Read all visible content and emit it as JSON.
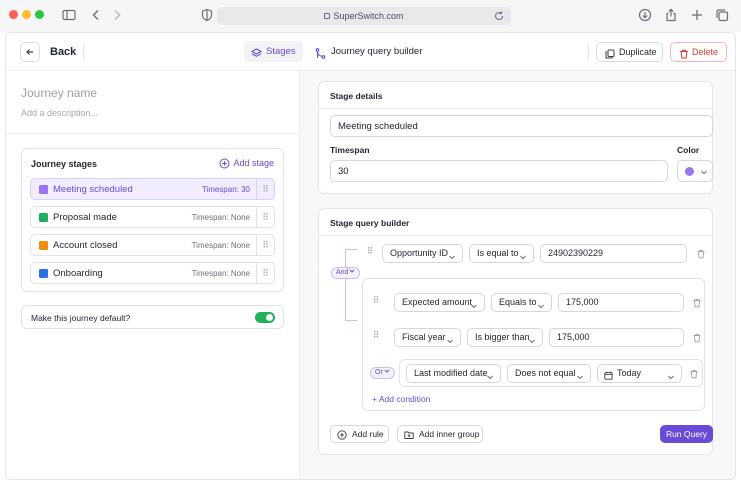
{
  "browser": {
    "url": "SuperSwitch.com"
  },
  "header": {
    "back_label": "Back",
    "stages_tab": "Stages",
    "builder_tab": "Journey query builder",
    "duplicate_label": "Duplicate",
    "delete_label": "Delete"
  },
  "journey": {
    "name_placeholder": "Journey name",
    "description_placeholder": "Add a description..."
  },
  "stages": {
    "title": "Journey stages",
    "add_label": "Add stage",
    "items": [
      {
        "name": "Meeting scheduled",
        "timespan": "Timespan: 30",
        "color": "#9b74ef",
        "selected": true
      },
      {
        "name": "Proposal made",
        "timespan": "Timespan: None",
        "color": "#1fae5b",
        "selected": false
      },
      {
        "name": "Account closed",
        "timespan": "Timespan: None",
        "color": "#f08c0a",
        "selected": false
      },
      {
        "name": "Onboarding",
        "timespan": "Timespan: None",
        "color": "#2f6fe5",
        "selected": false
      }
    ]
  },
  "default_toggle": {
    "label": "Make this journey default?",
    "on": true,
    "color": "#20b25a"
  },
  "stage_details": {
    "title": "Stage details",
    "name_value": "Meeting scheduled",
    "timespan_label": "Timespan",
    "timespan_value": "30",
    "color_label": "Color",
    "color_value": "#9b74ef"
  },
  "query_builder": {
    "title": "Stage query builder",
    "and_label": "And",
    "or_label": "Or",
    "rules": [
      {
        "field": "Opportunity ID",
        "operator": "Is equal to",
        "value": "24902390229"
      },
      {
        "field": "Expected amount",
        "operator": "Equals to",
        "value": "175,000"
      },
      {
        "field": "Fiscal year",
        "operator": "Is bigger than",
        "value": "175,000"
      },
      {
        "field": "Last modified date",
        "operator": "Does not equal",
        "value": "Today"
      }
    ],
    "add_condition_label": "Add condition",
    "add_rule_label": "Add rule",
    "add_group_label": "Add inner group",
    "run_label": "Run Query"
  },
  "accent_color": "#6a4bd6",
  "danger_color": "#d83b32"
}
